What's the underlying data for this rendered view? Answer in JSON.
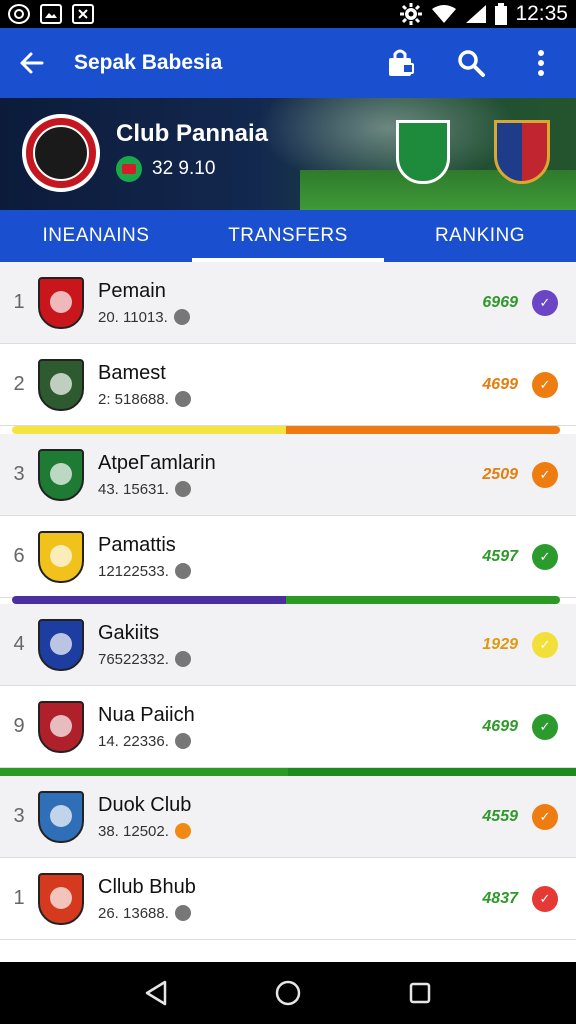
{
  "status_bar": {
    "time": "12:35",
    "icons": [
      "sync-icon",
      "image-icon",
      "box-x-icon",
      "settings-gear-icon",
      "wifi-icon",
      "signal-icon",
      "battery-icon"
    ]
  },
  "app_bar": {
    "title": "Sepak Babesia",
    "icons": [
      "back-arrow-icon",
      "bag-lock-icon",
      "search-icon",
      "more-vert-icon"
    ]
  },
  "club": {
    "name": "Club Pannaia",
    "meta": "32 9.10"
  },
  "tabs": [
    {
      "label": "INEANAINS"
    },
    {
      "label": "TRANSFERS"
    },
    {
      "label": "RANKING"
    }
  ],
  "rows": [
    {
      "rank": "1",
      "name": "Pemain",
      "sub": "20. 11013.",
      "points": "6969",
      "points_color": "#2e9a2a",
      "icon_color": "#6a45c6",
      "crest_color": "#c9161d"
    },
    {
      "rank": "2",
      "name": "Bamest",
      "sub": "2: 518688.",
      "points": "4699",
      "points_color": "#e67d0f",
      "icon_color": "#ef7c10",
      "crest_color": "#2d5a2e"
    },
    {
      "rank": "3",
      "name": "AtpeΓamlarin",
      "sub": "43. 15631.",
      "points": "2509",
      "points_color": "#e67d0f",
      "icon_color": "#ef7c10",
      "crest_color": "#1f7a33"
    },
    {
      "rank": "6",
      "name": "Pamattis",
      "sub": "12122533.",
      "points": "4597",
      "points_color": "#2e9a2a",
      "icon_color": "#2b9b2d",
      "crest_color": "#f2c21c"
    },
    {
      "rank": "4",
      "name": "Gakiits",
      "sub": "76522332.",
      "points": "1929",
      "points_color": "#e09a10",
      "icon_color": "#f2df3a",
      "crest_color": "#1d3ea0"
    },
    {
      "rank": "9",
      "name": "Nua Paiich",
      "sub": "14. 22336.",
      "points": "4699",
      "points_color": "#2e9a2a",
      "icon_color": "#2b9b2d",
      "crest_color": "#b0202a"
    },
    {
      "rank": "3",
      "name": "Duok Club",
      "sub": "38. 12502.",
      "points": "4559",
      "points_color": "#2e9a2a",
      "icon_color": "#ef7c10",
      "crest_color": "#2f6fb8"
    },
    {
      "rank": "1",
      "name": "Cllub Bhub",
      "sub": "26. 13688.",
      "points": "4837",
      "points_color": "#2e9a2a",
      "icon_color": "#e53935",
      "crest_color": "#d63a1e"
    }
  ],
  "colors": {
    "primary": "#1a4fd0",
    "divider_yellow": "#f4e442",
    "divider_orange": "#ee7b12",
    "divider_purple": "#4a2fa0",
    "divider_green": "#2a9a24"
  },
  "nav_bar": {
    "icons": [
      "nav-back-icon",
      "nav-home-icon",
      "nav-recents-icon"
    ]
  }
}
